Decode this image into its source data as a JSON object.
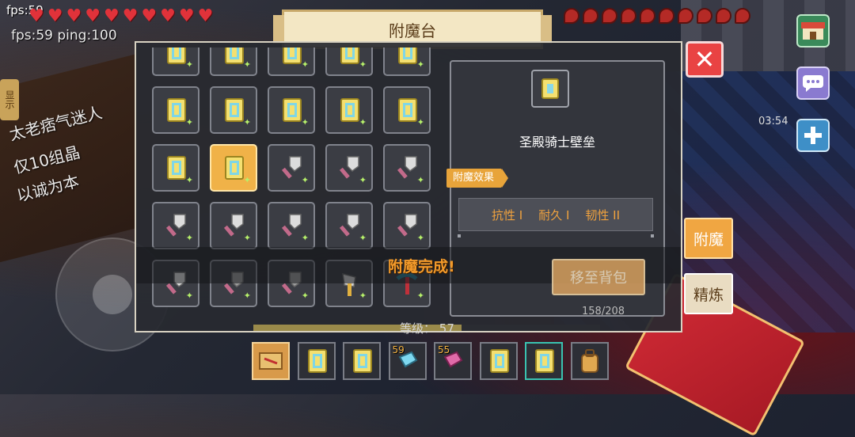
{
  "hud": {
    "fps_corner": "fps:59",
    "fps_ping": "fps:59 ping:100",
    "timer": "03:54",
    "side_note": "显示",
    "hearts_count": 10,
    "food_count": 10,
    "bg_sign_lines": [
      "太老痞气迷人",
      "仅10组晶",
      "以诚为本"
    ]
  },
  "panel": {
    "title": "附魔台",
    "close_label": "✕"
  },
  "grid": {
    "rows": [
      [
        "scroll",
        "scroll",
        "scroll",
        "scroll",
        "scroll"
      ],
      [
        "scroll",
        "scroll",
        "scroll",
        "scroll",
        "scroll"
      ],
      [
        "scroll",
        "scroll-selected",
        "shovel",
        "shovel",
        "shovel"
      ],
      [
        "shovel",
        "shovel",
        "shovel",
        "shovel",
        "shovel"
      ],
      [
        "shovel",
        "shovel-dark",
        "shovel-dark",
        "axe",
        "pickaxe"
      ]
    ]
  },
  "detail": {
    "item_name": "圣殿骑士壁垒",
    "effect_label": "附魔效果",
    "effects": [
      "抗性 I",
      "耐久 I",
      "韧性 II"
    ],
    "move_button": "移至背包"
  },
  "status": {
    "done_text": "附魔完成!",
    "level_label": "等级：",
    "level_value": "57",
    "bg_counter": "158/208",
    "level_fraction": 0.6
  },
  "tabs": {
    "enchant": "附魔",
    "refine": "精炼"
  },
  "hotbar": [
    {
      "icon": "map-scroll-icon",
      "count": "",
      "style": "active"
    },
    {
      "icon": "scroll-icon",
      "count": "",
      "style": ""
    },
    {
      "icon": "scroll-icon",
      "count": "",
      "style": ""
    },
    {
      "icon": "cyan-block-icon",
      "count": "59",
      "style": ""
    },
    {
      "icon": "pink-block-icon",
      "count": "55",
      "style": ""
    },
    {
      "icon": "scroll-icon",
      "count": "",
      "style": ""
    },
    {
      "icon": "scroll-icon",
      "count": "",
      "style": "teal"
    },
    {
      "icon": "backpack-icon",
      "count": "",
      "style": ""
    }
  ],
  "colors": {
    "accent_orange": "#f39a2a",
    "close_red": "#e94343",
    "selected_slot": "#f0b248"
  }
}
